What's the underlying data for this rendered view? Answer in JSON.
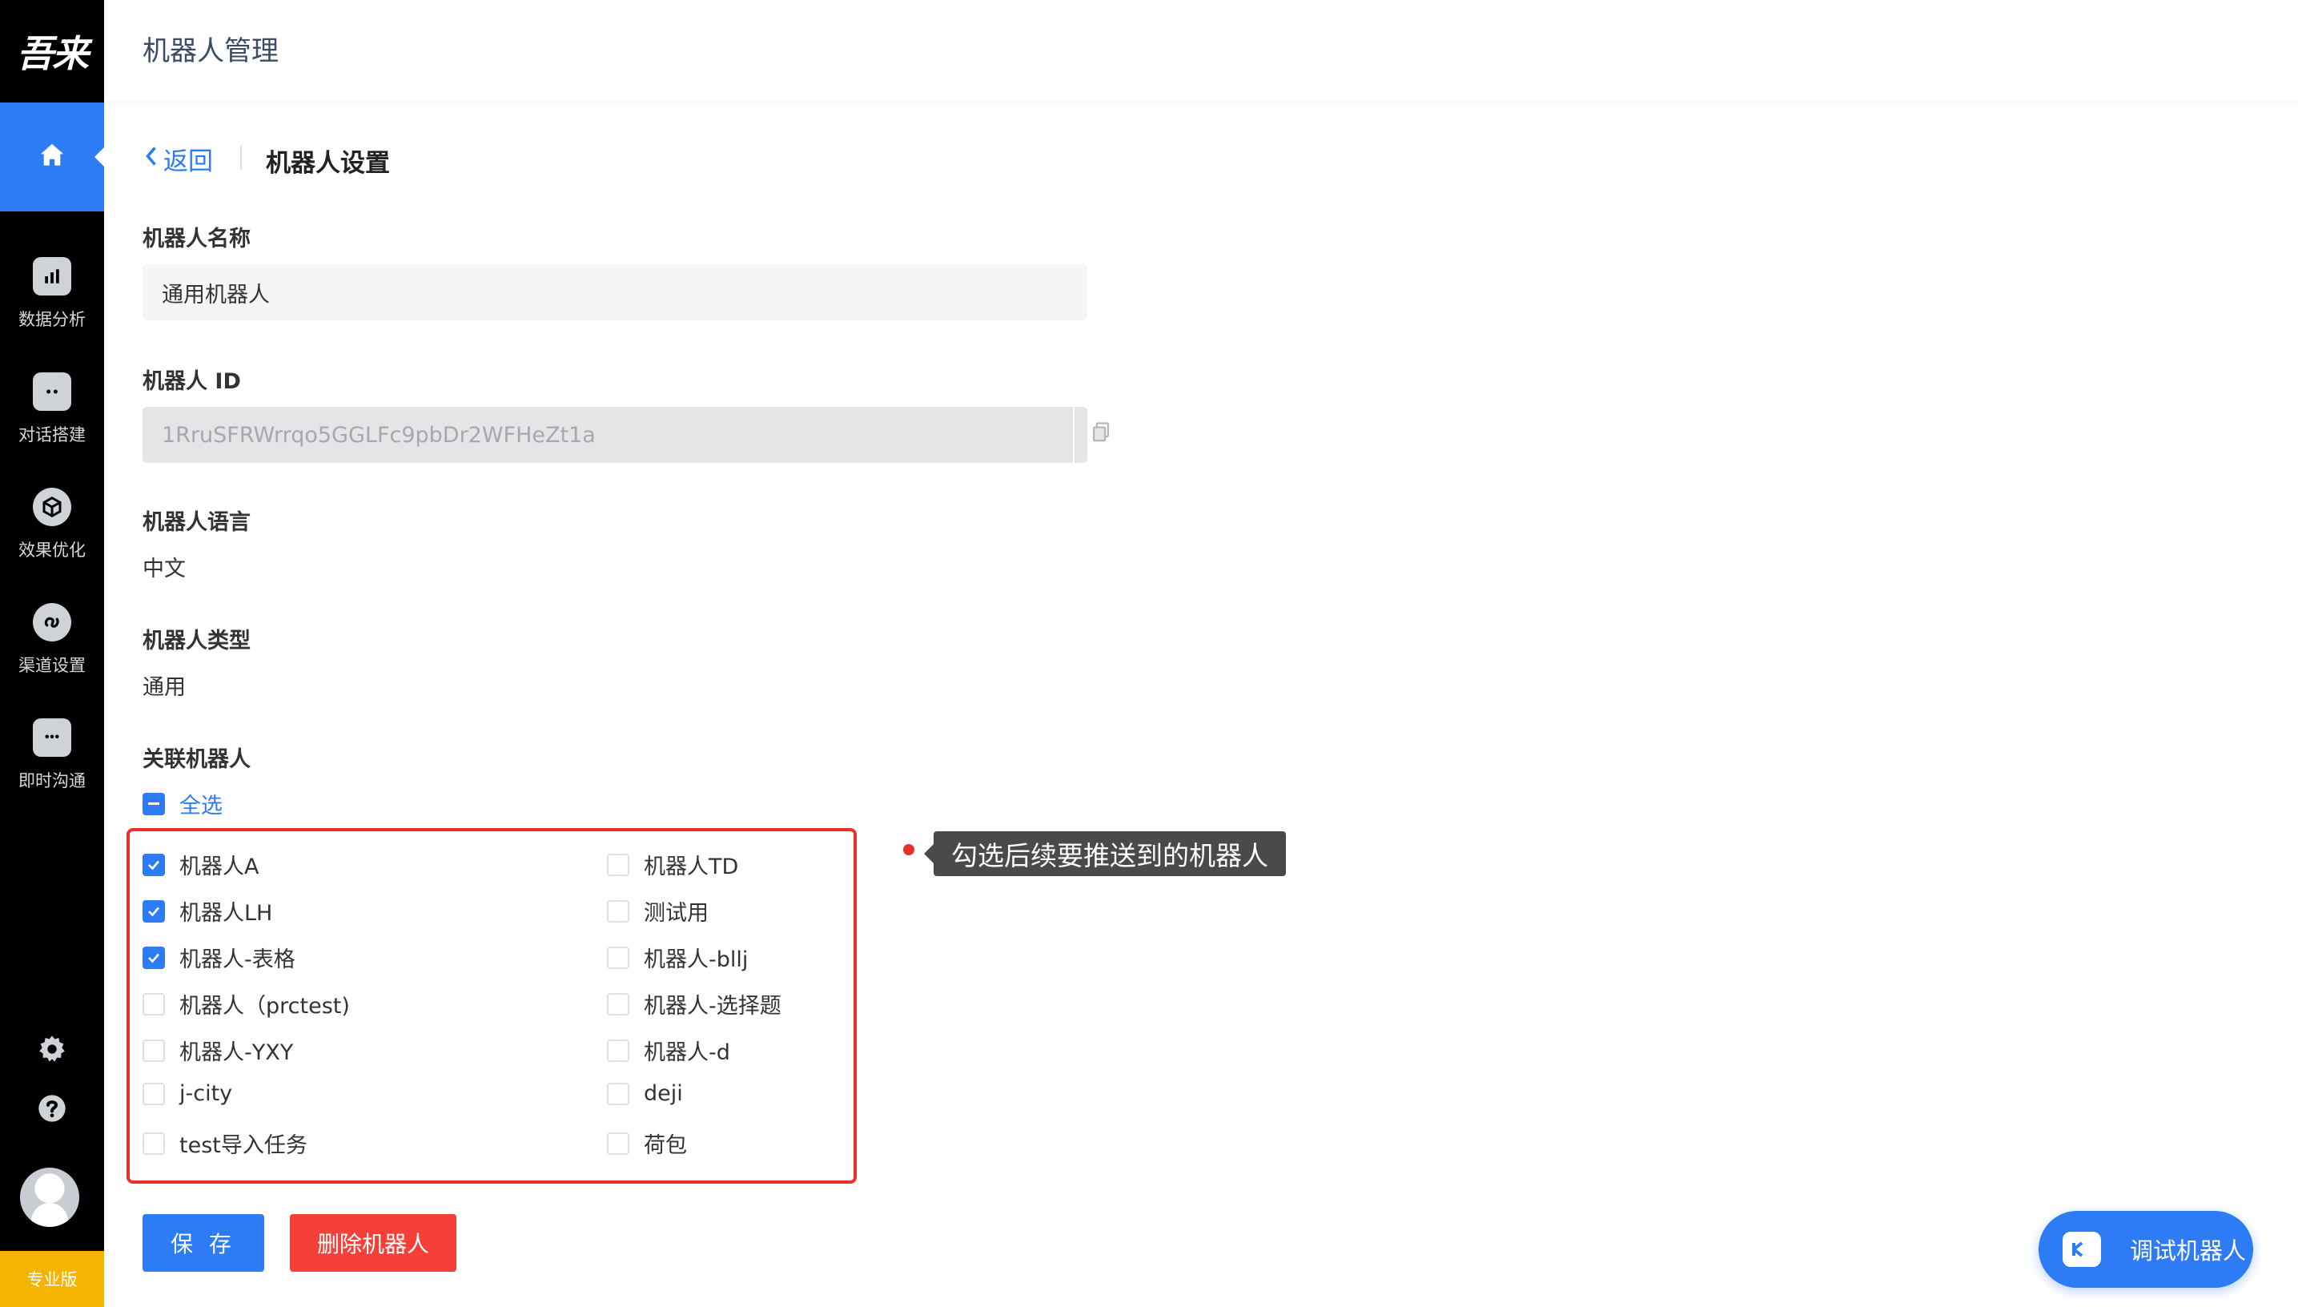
{
  "app": {
    "logo_text": "吾来",
    "header_title": "机器人管理",
    "plan_badge": "专业版"
  },
  "sidebar": {
    "items": [
      {
        "label": "数据分析",
        "icon": "bar-chart-icon"
      },
      {
        "label": "对话搭建",
        "icon": "robot-icon"
      },
      {
        "label": "效果优化",
        "icon": "cube-icon"
      },
      {
        "label": "渠道设置",
        "icon": "link-icon"
      },
      {
        "label": "即时沟通",
        "icon": "chat-bubble-icon"
      }
    ],
    "bottom_icons": [
      "gear-icon",
      "help-icon"
    ]
  },
  "breadcrumb": {
    "back_label": "返回",
    "title": "机器人设置"
  },
  "form": {
    "name_label": "机器人名称",
    "name_value": "通用机器人",
    "id_label": "机器人 ID",
    "id_value": "1RruSFRWrrqo5GGLFc9pbDr2WFHeZt1a",
    "language_label": "机器人语言",
    "language_value": "中文",
    "type_label": "机器人类型",
    "type_value": "通用",
    "related_label": "关联机器人",
    "select_all_label": "全选"
  },
  "related_bots": {
    "left": [
      {
        "label": "机器人A",
        "checked": true
      },
      {
        "label": "机器人LH",
        "checked": true
      },
      {
        "label": "机器人-表格",
        "checked": true
      },
      {
        "label": "机器人（prctest)",
        "checked": false
      },
      {
        "label": "机器人-YXY",
        "checked": false
      },
      {
        "label": "j-city",
        "checked": false
      },
      {
        "label": "test导入任务",
        "checked": false
      }
    ],
    "right": [
      {
        "label": "机器人TD",
        "checked": false
      },
      {
        "label": "测试用",
        "checked": false
      },
      {
        "label": "机器人-bllj",
        "checked": false
      },
      {
        "label": "机器人-选择题",
        "checked": false
      },
      {
        "label": "机器人-d",
        "checked": false
      },
      {
        "label": "deji",
        "checked": false
      },
      {
        "label": "荷包",
        "checked": false
      }
    ]
  },
  "annotation": {
    "text": "勾选后续要推送到的机器人"
  },
  "actions": {
    "save_label": "保 存",
    "delete_label": "删除机器人",
    "debug_label": "调试机器人"
  },
  "colors": {
    "primary": "#2d7cf6",
    "danger": "#f5403a",
    "sidebar_bg": "#000000",
    "badge": "#f5b400"
  }
}
